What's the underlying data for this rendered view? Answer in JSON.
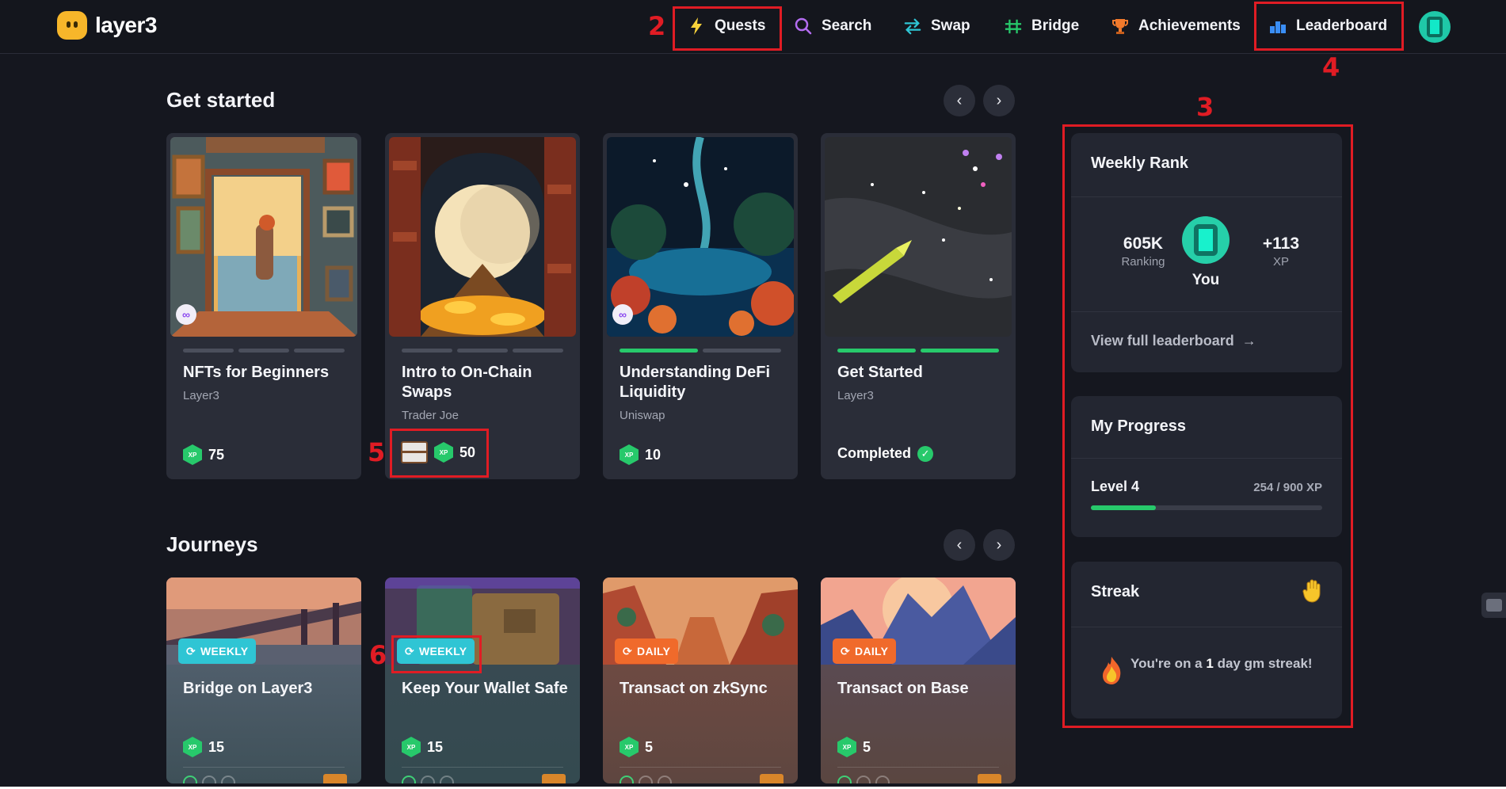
{
  "app": {
    "brand": "layer3",
    "nav": {
      "quests": "Quests",
      "search": "Search",
      "swap": "Swap",
      "bridge": "Bridge",
      "achievements": "Achievements",
      "leaderboard": "Leaderboard"
    }
  },
  "annotations": [
    "2",
    "3",
    "4",
    "5",
    "6"
  ],
  "get_started": {
    "title": "Get started",
    "cards": [
      {
        "title": "NFTs for Beginners",
        "sub": "Layer3",
        "xp": "75",
        "progress": [
          0,
          0,
          0
        ]
      },
      {
        "title": "Intro to On-Chain Swaps",
        "sub": "Trader Joe",
        "xp": "50",
        "progress": [
          0,
          0,
          0
        ]
      },
      {
        "title": "Understanding DeFi Liquidity",
        "sub": "Uniswap",
        "xp": "10",
        "progress": [
          1,
          0
        ]
      },
      {
        "title": "Get Started",
        "sub": "Layer3",
        "status": "Completed",
        "progress": [
          1,
          1
        ]
      }
    ]
  },
  "journeys": {
    "title": "Journeys",
    "cards": [
      {
        "badge": "WEEKLY",
        "title": "Bridge on Layer3",
        "xp": "15"
      },
      {
        "badge": "WEEKLY",
        "title": "Keep Your Wallet Safe",
        "xp": "15"
      },
      {
        "badge": "DAILY",
        "title": "Transact on zkSync",
        "xp": "5"
      },
      {
        "badge": "DAILY",
        "title": "Transact on Base",
        "xp": "5"
      }
    ]
  },
  "weekly_rank": {
    "title": "Weekly Rank",
    "ranking_value": "605K",
    "ranking_label": "Ranking",
    "you_label": "You",
    "xp_value": "+113",
    "xp_label": "XP",
    "link": "View full leaderboard"
  },
  "my_progress": {
    "title": "My Progress",
    "level": "Level 4",
    "xp_text": "254 / 900 XP",
    "fraction": 0.282
  },
  "streak": {
    "title": "Streak",
    "text_prefix": "You're on a",
    "days": "1",
    "text_suffix": "day gm streak!"
  },
  "xp_tag": "XP",
  "colors": {
    "background": "#15171f",
    "card": "#2a2d38",
    "accent_green": "#27c96b",
    "weekly": "#2fc5d4",
    "daily": "#f06a2b",
    "annotation": "#e01c24"
  }
}
